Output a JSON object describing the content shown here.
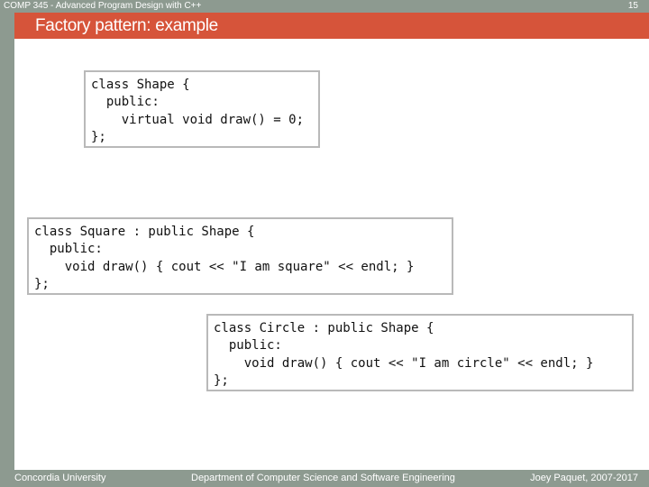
{
  "header": {
    "course": "COMP 345 - Advanced Program Design with C++",
    "page_number": "15"
  },
  "slide": {
    "title": "Factory pattern: example"
  },
  "code_blocks": {
    "shape": {
      "lines": [
        "class Shape {",
        "  public:",
        "    virtual void draw() = 0;",
        "};"
      ]
    },
    "square": {
      "lines": [
        "class Square : public Shape {",
        "  public:",
        "    void draw() { cout << \"I am square\" << endl; }",
        "};"
      ]
    },
    "circle": {
      "lines": [
        "class Circle : public Shape {",
        "  public:",
        "    void draw() { cout << \"I am circle\" << endl; }",
        "};"
      ]
    }
  },
  "footer": {
    "left": "Concordia University",
    "center": "Department of Computer Science and Software Engineering",
    "right": "Joey Paquet, 2007-2017"
  }
}
